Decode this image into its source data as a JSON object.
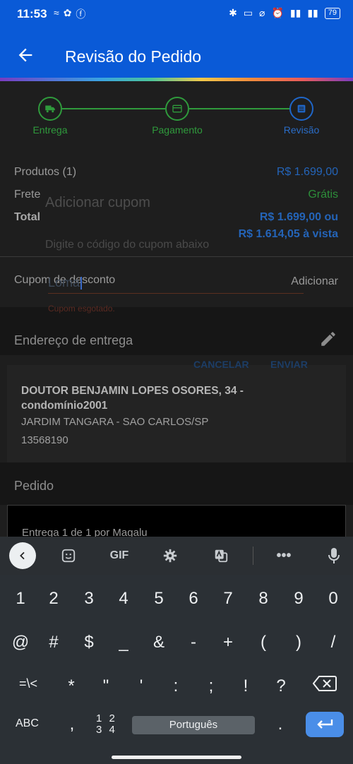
{
  "status": {
    "time": "11:53",
    "battery": "79"
  },
  "app_bar": {
    "title": "Revisão do Pedido"
  },
  "stepper": {
    "steps": [
      {
        "label": "Entrega"
      },
      {
        "label": "Pagamento"
      },
      {
        "label": "Revisão"
      }
    ]
  },
  "summary": {
    "products_label": "Produtos (1)",
    "products_value": "R$ 1.699,00",
    "shipping_label": "Frete",
    "shipping_value": "Grátis",
    "total_label": "Total",
    "total_value_1": "R$ 1.699,00 ou",
    "total_value_2": "R$ 1.614,05 à vista"
  },
  "coupon_row": {
    "label": "Cupom de desconto",
    "action": "Adicionar"
  },
  "dialog": {
    "title": "Adicionar cupom",
    "message": "Digite o código do cupom abaixo",
    "input_value": "Loma",
    "error": "Cupom esgotado.",
    "cancel": "CANCELAR",
    "send": "ENVIAR"
  },
  "address": {
    "section_title": "Endereço de entrega",
    "line1": "DOUTOR BENJAMIN LOPES OSORES, 34 - condomínio2001",
    "line2": "JARDIM TANGARA - SAO CARLOS/SP",
    "line3": "13568190"
  },
  "order": {
    "section_title": "Pedido",
    "card_text": "Entrega 1 de 1 por Magalu"
  },
  "keyboard": {
    "toolbar": {
      "gif": "GIF"
    },
    "row1": [
      "1",
      "2",
      "3",
      "4",
      "5",
      "6",
      "7",
      "8",
      "9",
      "0"
    ],
    "row2": [
      "@",
      "#",
      "$",
      "_",
      "&",
      "-",
      "+",
      "(",
      ")",
      "/"
    ],
    "row3": [
      "=\\<",
      "*",
      "\"",
      "'",
      ":",
      ";",
      "!",
      "?"
    ],
    "abc": "ABC",
    "comma": ",",
    "num_top": "1 2",
    "num_bottom": "3 4",
    "space": "Português",
    "period": "."
  }
}
